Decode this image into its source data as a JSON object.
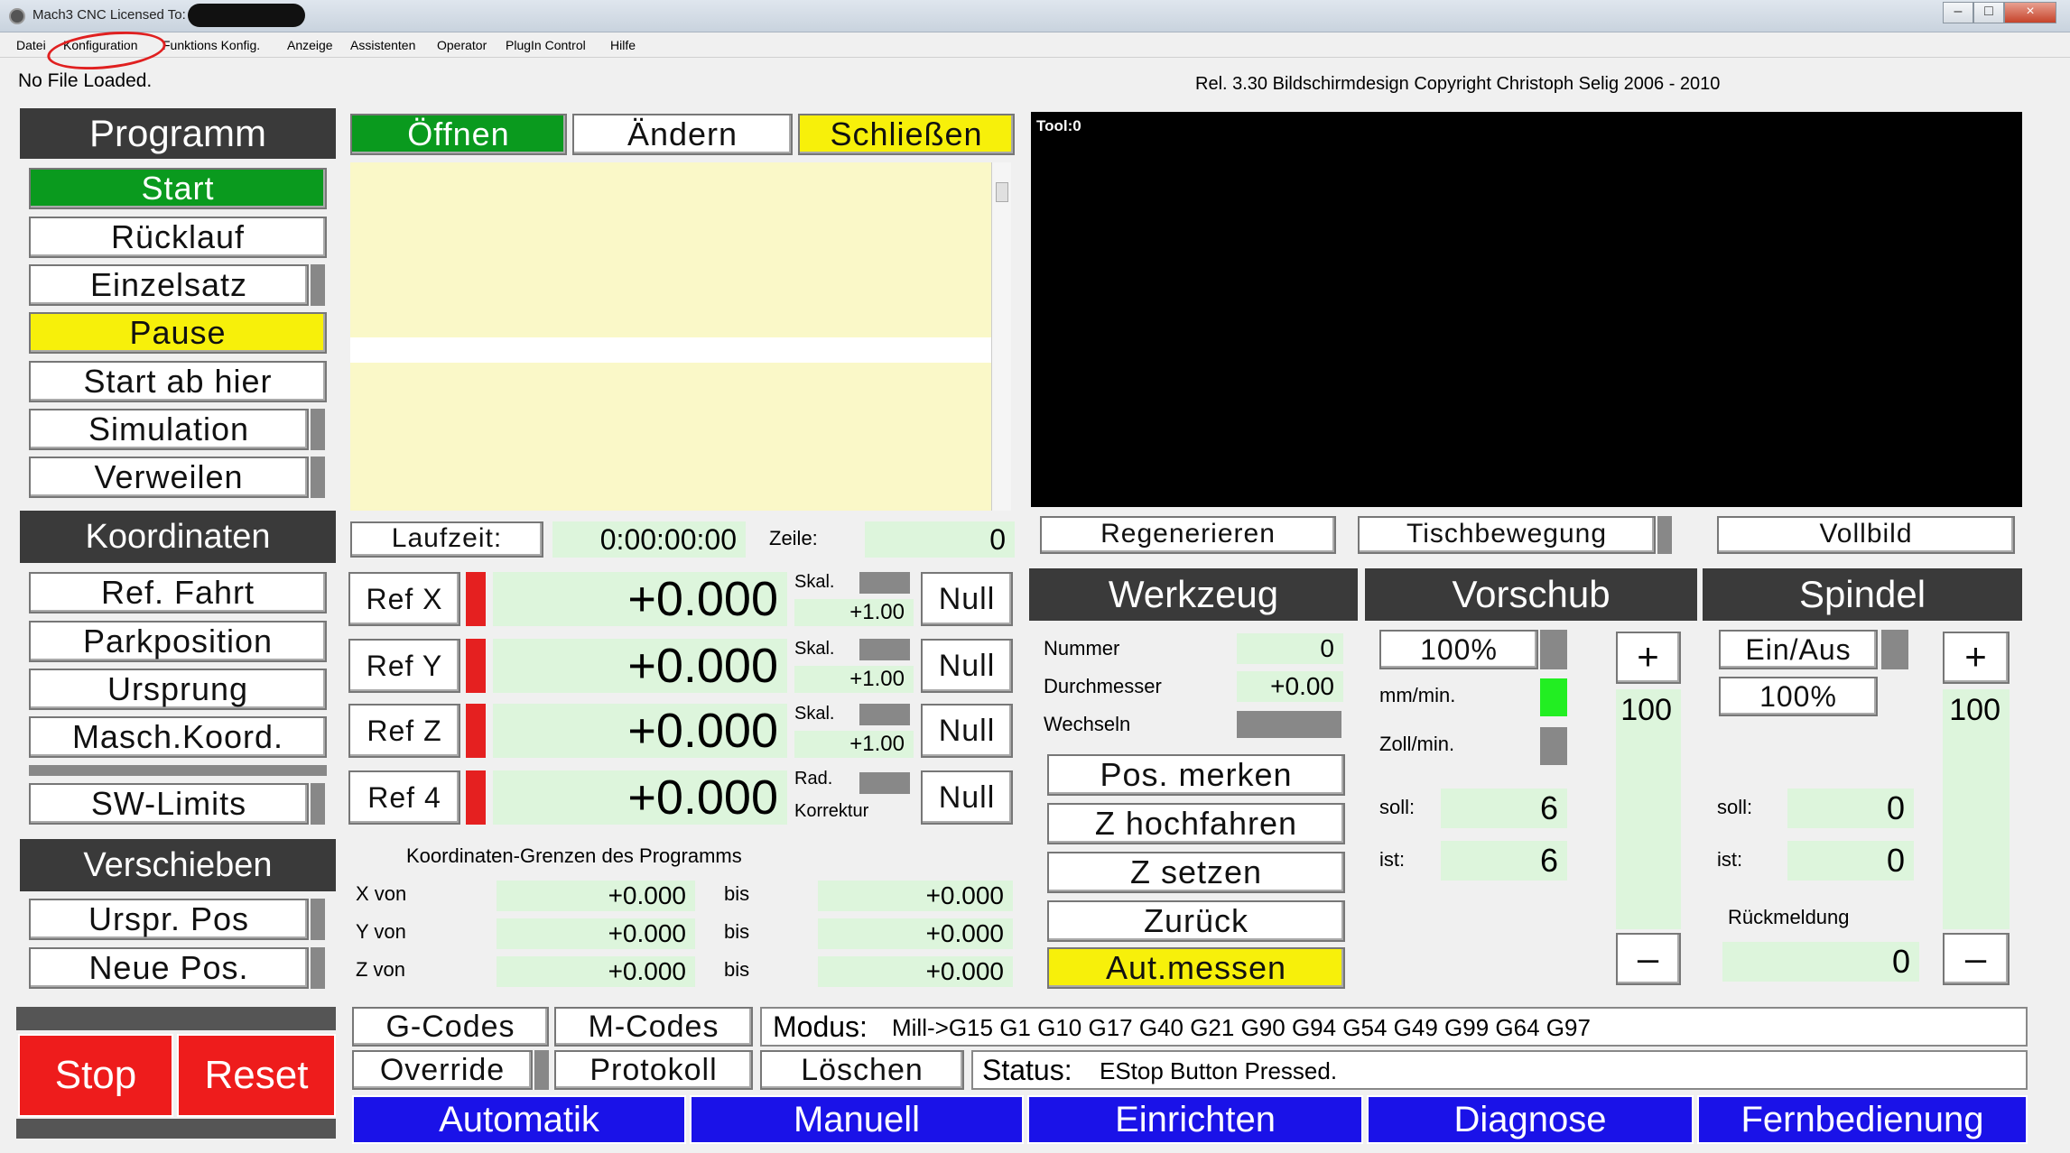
{
  "window": {
    "title": "Mach3 CNC  Licensed To:",
    "min": "–",
    "max": "□",
    "close": "×"
  },
  "menu": [
    "Datei",
    "Konfiguration",
    "Funktions Konfig.",
    "Anzeige",
    "Assistenten",
    "Operator",
    "PlugIn Control",
    "Hilfe"
  ],
  "file_status": "No File Loaded.",
  "copyright": "Rel. 3.30 Bildschirmdesign Copyright Christoph Selig 2006 - 2010",
  "toolpath": {
    "tool_label": "Tool:0"
  },
  "programm": {
    "header": "Programm",
    "start": "Start",
    "ruecklauf": "Rücklauf",
    "einzelsatz": "Einzelsatz",
    "pause": "Pause",
    "start_ab_hier": "Start ab hier",
    "simulation": "Simulation",
    "verweilen": "Verweilen"
  },
  "file_buttons": {
    "oeffnen": "Öffnen",
    "aendern": "Ändern",
    "schliessen": "Schließen"
  },
  "laufzeit": {
    "label": "Laufzeit:",
    "value": "0:00:00:00",
    "zeile_label": "Zeile:",
    "zeile_value": "0"
  },
  "view_buttons": {
    "regenerieren": "Regenerieren",
    "tischbewegung": "Tischbewegung",
    "vollbild": "Vollbild"
  },
  "koordinaten": {
    "header": "Koordinaten",
    "ref_fahrt": "Ref. Fahrt",
    "parkposition": "Parkposition",
    "ursprung": "Ursprung",
    "masch_koord": "Masch.Koord.",
    "sw_limits": "SW-Limits"
  },
  "axes": [
    {
      "ref": "Ref X",
      "value": "+0.000",
      "skal": "Skal.",
      "scale": "+1.00",
      "null": "Null"
    },
    {
      "ref": "Ref Y",
      "value": "+0.000",
      "skal": "Skal.",
      "scale": "+1.00",
      "null": "Null"
    },
    {
      "ref": "Ref Z",
      "value": "+0.000",
      "skal": "Skal.",
      "scale": "+1.00",
      "null": "Null"
    },
    {
      "ref": "Ref 4",
      "value": "+0.000",
      "skal": "Rad.",
      "scale": "Korrektur",
      "null": "Null"
    }
  ],
  "verschieben": {
    "header": "Verschieben",
    "urspr_pos": "Urspr. Pos",
    "neue_pos": "Neue Pos."
  },
  "grenzen": {
    "title": "Koordinaten-Grenzen des Programms",
    "rows": [
      {
        "label": "X von",
        "from": "+0.000",
        "bis": "bis",
        "to": "+0.000"
      },
      {
        "label": "Y von",
        "from": "+0.000",
        "bis": "bis",
        "to": "+0.000"
      },
      {
        "label": "Z von",
        "from": "+0.000",
        "bis": "bis",
        "to": "+0.000"
      }
    ]
  },
  "werkzeug": {
    "header": "Werkzeug",
    "nummer_label": "Nummer",
    "nummer": "0",
    "durchmesser_label": "Durchmesser",
    "durchmesser": "+0.00",
    "wechseln_label": "Wechseln",
    "pos_merken": "Pos. merken",
    "z_hochfahren": "Z hochfahren",
    "z_setzen": "Z setzen",
    "zurueck": "Zurück",
    "aut_messen": "Aut.messen"
  },
  "vorschub": {
    "header": "Vorschub",
    "percent": "100%",
    "mm_min": "mm/min.",
    "zoll_min": "Zoll/min.",
    "soll_label": "soll:",
    "soll": "6",
    "ist_label": "ist:",
    "ist": "6",
    "plus": "+",
    "minus": "–",
    "override": "100"
  },
  "spindel": {
    "header": "Spindel",
    "ein_aus": "Ein/Aus",
    "percent": "100%",
    "soll_label": "soll:",
    "soll": "0",
    "ist_label": "ist:",
    "ist": "0",
    "rueckmeldung_label": "Rückmeldung",
    "rueckmeldung": "0",
    "plus": "+",
    "minus": "–",
    "override": "100"
  },
  "bottom": {
    "stop": "Stop",
    "reset": "Reset",
    "gcodes": "G-Codes",
    "mcodes": "M-Codes",
    "override": "Override",
    "protokoll": "Protokoll",
    "loeschen": "Löschen",
    "modus_label": "Modus:",
    "modus": "Mill->G15  G1 G10 G17 G40 G21 G90 G94 G54 G49 G99 G64 G97",
    "status_label": "Status:",
    "status": "EStop Button Pressed."
  },
  "tabs": [
    "Automatik",
    "Manuell",
    "Einrichten",
    "Diagnose",
    "Fernbedienung"
  ],
  "colors": {
    "green": "#0a9a1e",
    "yellow": "#f7f00a",
    "red": "#ee1c1c",
    "blue": "#1a12e8",
    "dro_green": "#ddf5dc",
    "header_gray": "#3a3a3a",
    "code_yellow": "#faf8c8"
  }
}
